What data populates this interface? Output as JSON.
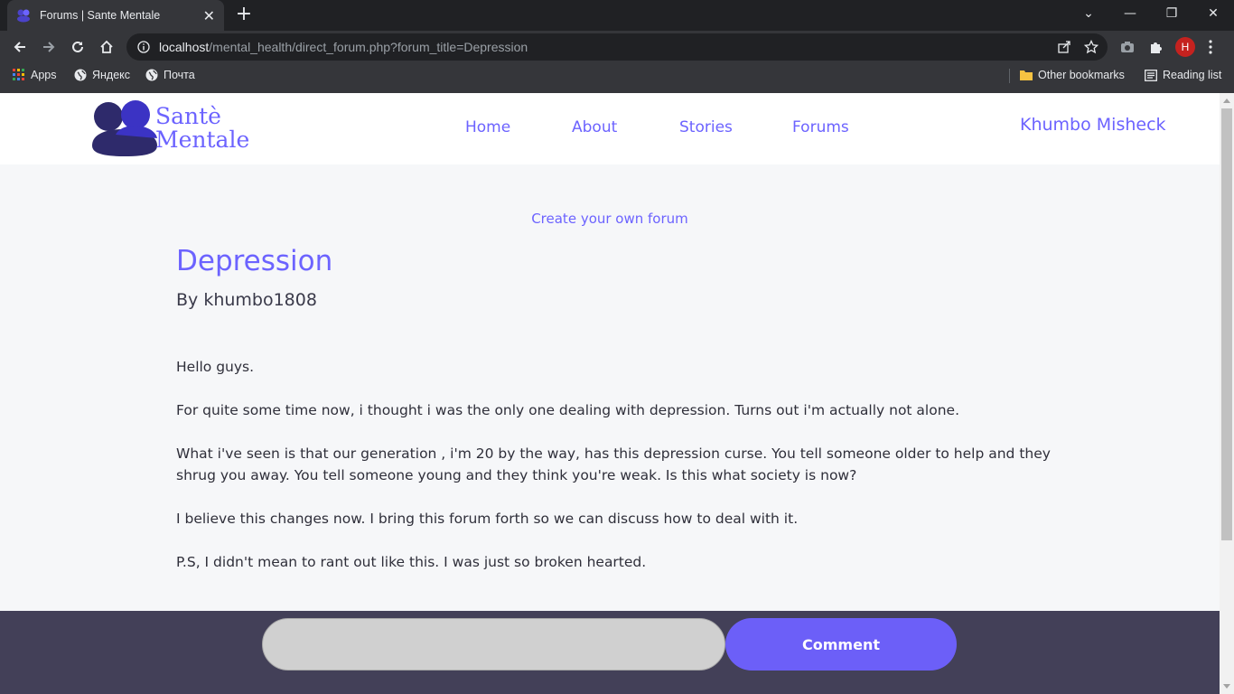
{
  "browser": {
    "tab_title": "Forums | Sante Mentale",
    "tab_close": "✕",
    "new_tab": "+",
    "url_host": "localhost",
    "url_path": "/mental_health/direct_forum.php?forum_title=Depression",
    "avatar_letter": "H",
    "bookmarks": [
      {
        "label": "Apps",
        "icon": "apps-grid-icon"
      },
      {
        "label": "Яндекс",
        "icon": "globe-icon"
      },
      {
        "label": "Почта",
        "icon": "globe-icon"
      }
    ],
    "other_bookmarks": "Other bookmarks",
    "reading_list": "Reading list"
  },
  "site": {
    "logo_line1": "Santè",
    "logo_line2": "Mentale",
    "nav": {
      "home": "Home",
      "about": "About",
      "stories": "Stories",
      "forums": "Forums"
    },
    "user_name": "Khumbo Misheck",
    "accent_color": "#6c63ff"
  },
  "forum": {
    "create_link": "Create your own forum",
    "title": "Depression",
    "author": "By khumbo1808",
    "paragraphs": [
      "Hello guys.",
      "For quite some time now, i thought i was the only one dealing with depression. Turns out i'm actually not alone.",
      "What i've seen is that our generation , i'm 20 by the way, has this depression curse. You tell someone older to help and they shrug you away. You tell someone young and they think you're weak. Is this what society is now?",
      "I believe this changes now. I bring this forum forth so we can discuss how to deal with it.",
      "P.S, I didn't mean to rant out like this. I was just so broken hearted."
    ]
  },
  "comment": {
    "input_value": "",
    "button_label": "Comment"
  }
}
